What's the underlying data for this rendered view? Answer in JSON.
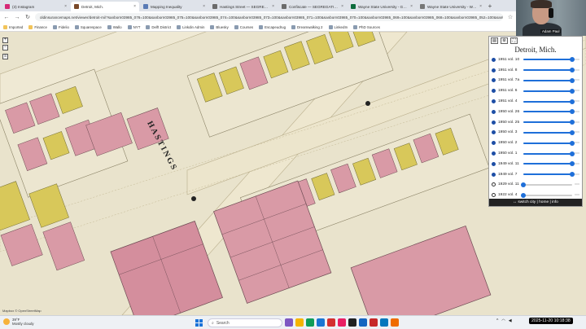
{
  "browser": {
    "tabs": [
      {
        "label": "(3) Instagram",
        "color": "#d62976"
      },
      {
        "label": "Detroit, Mich.",
        "color": "#7a4a2a",
        "active": true
      },
      {
        "label": "Mapping Inequality",
        "color": "#5a7bb5"
      },
      {
        "label": "Hastings Street — SEGREGATI...",
        "color": "#6b6b6b"
      },
      {
        "label": "Confiscate — SEGREGATION IN",
        "color": "#6b6b6b"
      },
      {
        "label": "Wayne State University - Goog",
        "color": "#0c6b3c"
      },
      {
        "label": "Wayne State University - Wikip",
        "color": "#777777"
      }
    ],
    "new_tab": "+",
    "url": "oldinsurancemaps.net/viewer/detroit-mi/?sanborn03985_076=100&sanborn03985_075=100&sanborn03985_074=100&sanborn03985_073=100&sanborn03985_071=100&sanborn03985_070=100&sanborn03985_069=100&sanborn03985_068=100&sanborn03985_052=100&sanborn03985_..."
  },
  "bookmarks": [
    {
      "label": "Imported",
      "folder": true
    },
    {
      "label": "Finance",
      "folder": true
    },
    {
      "label": "Fidelio",
      "folder": false
    },
    {
      "label": "Squarespace",
      "folder": false
    },
    {
      "label": "Wallo",
      "folder": false
    },
    {
      "label": "NYT",
      "folder": false
    },
    {
      "label": "Delft District",
      "folder": false
    },
    {
      "label": "Linkdin Admin",
      "folder": false
    },
    {
      "label": "Bluesky",
      "folder": false
    },
    {
      "label": "Courses",
      "folder": false
    },
    {
      "label": "Escapeudrug",
      "folder": false
    },
    {
      "label": "Dreamwalking 2",
      "folder": false
    },
    {
      "label": "LinkedIn",
      "folder": false
    },
    {
      "label": "PhD Sources",
      "folder": false
    }
  ],
  "map": {
    "street_label": "HASTINGS",
    "zoom_in": "+",
    "zoom_out": "−",
    "layers": "≡",
    "attribution": "Mapbox © OpenStreetMap"
  },
  "panel": {
    "title": "Detroit, Mich.",
    "volumes": [
      {
        "label": "1951 vol. 10",
        "checked": true,
        "opacity": 1.0
      },
      {
        "label": "1951 vol. 8",
        "checked": true,
        "opacity": 1.0
      },
      {
        "label": "1951 vol. 7a",
        "checked": true,
        "opacity": 1.0
      },
      {
        "label": "1951 vol. 6",
        "checked": true,
        "opacity": 1.0
      },
      {
        "label": "1951 vol. 4",
        "checked": true,
        "opacity": 1.0
      },
      {
        "label": "1950 vol. 26",
        "checked": true,
        "opacity": 1.0
      },
      {
        "label": "1950 vol. 25",
        "checked": true,
        "opacity": 1.0
      },
      {
        "label": "1950 vol. 3",
        "checked": true,
        "opacity": 1.0
      },
      {
        "label": "1950 vol. 2",
        "checked": true,
        "opacity": 1.0
      },
      {
        "label": "1950 vol. 1",
        "checked": true,
        "opacity": 1.0
      },
      {
        "label": "1949 vol. 11",
        "checked": true,
        "opacity": 1.0
      },
      {
        "label": "1949 vol. 7",
        "checked": true,
        "opacity": 1.0
      },
      {
        "label": "1929 vol. 11",
        "checked": false,
        "opacity": 0.0
      },
      {
        "label": "1922 vol. 4",
        "checked": false,
        "opacity": 0.0
      }
    ],
    "more": "⋯",
    "footer": "↔ switch city | home | info"
  },
  "webcam": {
    "name": "Adam Paul"
  },
  "taskbar": {
    "weather_temp": "39°F",
    "weather_desc": "Mostly cloudy",
    "search_placeholder": "Search",
    "clock": "2025-11-20  10:18:38"
  },
  "colors": {
    "accent": "#1e6fd9",
    "brick": "#d89aa8",
    "frame": "#dcc95a",
    "paper": "#e9e3cc"
  }
}
